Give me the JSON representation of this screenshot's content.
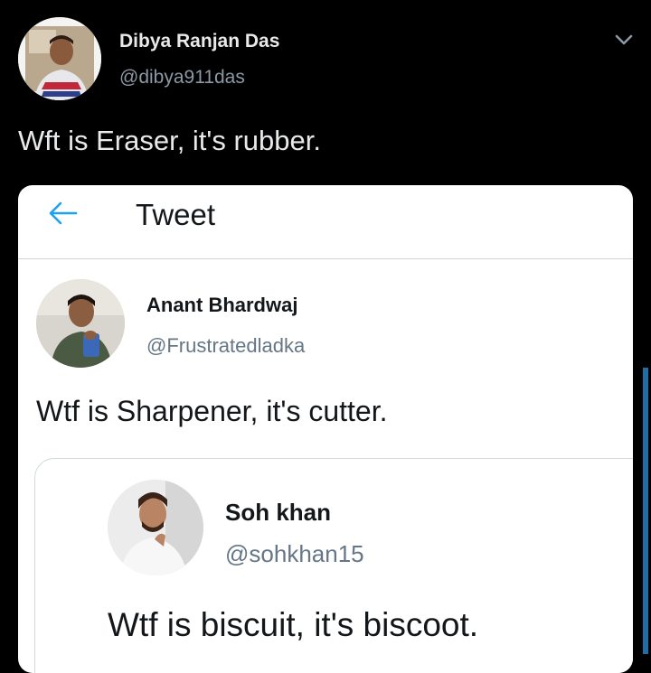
{
  "outer_tweet": {
    "author_name": "Dibya Ranjan Das",
    "handle": "@dibya911das",
    "text": "Wft is Eraser, it's rubber.",
    "menu_icon": "chevron-down-icon"
  },
  "screenshot": {
    "header": {
      "back_icon": "back-arrow-icon",
      "title": "Tweet"
    },
    "tweet": {
      "author_name": "Anant Bhardwaj",
      "handle": "@Frustratedladka",
      "text": "Wtf is Sharpener, it's cutter."
    },
    "quoted_tweet": {
      "author_name": "Soh khan",
      "handle": "@sohkhan15",
      "text": "Wtf is biscuit, it's biscoot."
    }
  },
  "colors": {
    "background": "#000000",
    "accent": "#1da1f2",
    "scrollbar": "#1d6fa5"
  }
}
